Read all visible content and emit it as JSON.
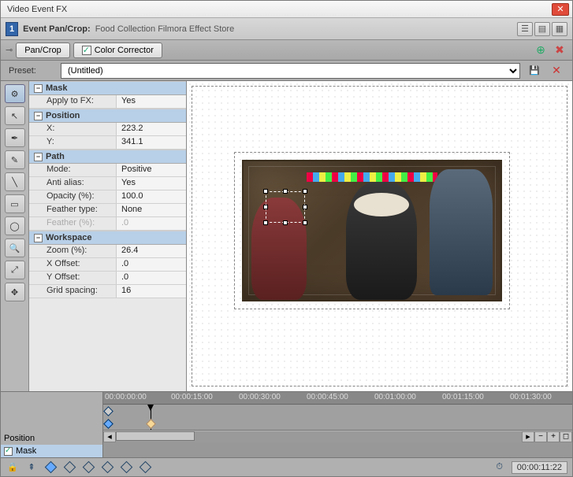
{
  "window": {
    "title": "Video Event FX"
  },
  "header": {
    "badge": "1",
    "label": "Event Pan/Crop:",
    "sub": "Food Collection  Filmora Effect Store"
  },
  "tabs": {
    "pancrop": "Pan/Crop",
    "colorcorr": "Color Corrector"
  },
  "preset": {
    "label": "Preset:",
    "value": "(Untitled)"
  },
  "props": {
    "mask": {
      "header": "Mask",
      "apply_to_fx_k": "Apply to FX:",
      "apply_to_fx_v": "Yes"
    },
    "position": {
      "header": "Position",
      "x_k": "X:",
      "x_v": "223.2",
      "y_k": "Y:",
      "y_v": "341.1"
    },
    "path": {
      "header": "Path",
      "mode_k": "Mode:",
      "mode_v": "Positive",
      "aa_k": "Anti alias:",
      "aa_v": "Yes",
      "op_k": "Opacity (%):",
      "op_v": "100.0",
      "ft_k": "Feather type:",
      "ft_v": "None",
      "fp_k": "Feather (%):",
      "fp_v": ".0"
    },
    "workspace": {
      "header": "Workspace",
      "zoom_k": "Zoom (%):",
      "zoom_v": "26.4",
      "xo_k": "X Offset:",
      "xo_v": ".0",
      "yo_k": "Y Offset:",
      "yo_v": ".0",
      "gs_k": "Grid spacing:",
      "gs_v": "16"
    }
  },
  "timeline": {
    "tracks": {
      "position": "Position",
      "mask": "Mask"
    },
    "ticks": [
      "00:00:00:00",
      "00:00:15:00",
      "00:00:30:00",
      "00:00:45:00",
      "00:01:00:00",
      "00:01:15:00",
      "00:01:30:00"
    ],
    "timecode": "00:00:11:22"
  }
}
